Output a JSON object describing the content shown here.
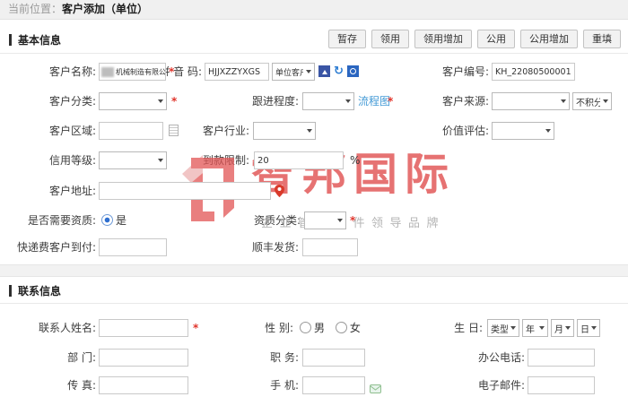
{
  "breadcrumb": {
    "prefix": "当前位置：",
    "current": "客户添加（单位）"
  },
  "toolbar": {
    "buttons": [
      "暂存",
      "领用",
      "领用增加",
      "公用",
      "公用增加",
      "重填"
    ]
  },
  "sections": {
    "basic": "基本信息",
    "contact": "联系信息"
  },
  "marks": {
    "required": "*"
  },
  "form": {
    "customer_name": {
      "label": "客户名称:",
      "value": "机械制造有限公司"
    },
    "pinyin": {
      "label": "拼 音 码:",
      "value": "HJJXZZYXGS"
    },
    "customer_type": {
      "value": "单位客户"
    },
    "customer_no": {
      "label": "客户编号:",
      "value": "KH_22080500001"
    },
    "customer_category": {
      "label": "客户分类:",
      "value": ""
    },
    "follow_degree": {
      "label": "跟进程度:",
      "value": "",
      "link": "流程图"
    },
    "customer_source": {
      "label": "客户来源:",
      "value": "",
      "points": "不积分"
    },
    "customer_region": {
      "label": "客户区域:",
      "value": ""
    },
    "customer_industry": {
      "label": "客户行业:",
      "value": ""
    },
    "value_assessment": {
      "label": "价值评估:",
      "value": ""
    },
    "credit_rating": {
      "label": "信用等级:",
      "value": ""
    },
    "payment_limit": {
      "label": "到款限制:",
      "value": "20",
      "suffix": "%"
    },
    "customer_address": {
      "label": "客户地址:",
      "value": ""
    },
    "need_qualification": {
      "label": "是否需要资质:",
      "option_yes": "是"
    },
    "qualification_category": {
      "label": "资质分类:",
      "value": ""
    },
    "express_fee": {
      "label": "快递费客户到付:",
      "value": ""
    },
    "sf_delivery": {
      "label": "顺丰发货:",
      "value": ""
    }
  },
  "contact": {
    "contact_name": {
      "label": "联系人姓名:",
      "value": ""
    },
    "gender": {
      "label": "性 别:",
      "male": "男",
      "female": "女"
    },
    "birthday": {
      "label": "生 日:",
      "type": "类型",
      "year": "年",
      "month": "月",
      "day": "日"
    },
    "department": {
      "label": "部 门:",
      "value": ""
    },
    "position": {
      "label": "职 务:",
      "value": ""
    },
    "office_phone": {
      "label": "办公电话:",
      "value": ""
    },
    "fax": {
      "label": "传 真:",
      "value": ""
    },
    "mobile": {
      "label": "手 机:",
      "value": ""
    },
    "email": {
      "label": "电子邮件:",
      "value": ""
    }
  },
  "watermark": {
    "brand": "智邦国际",
    "slogan": "企业管理软件领导品牌",
    "brand_color": "#e05050",
    "slogan_color": "#a9a9a9"
  },
  "icons": {
    "photo": "photo-icon",
    "sync": "sync-icon",
    "history": "history-icon",
    "region": "region-list-icon",
    "pin": "map-pin-icon",
    "sms": "sms-icon",
    "sync_glyph": "↻"
  }
}
